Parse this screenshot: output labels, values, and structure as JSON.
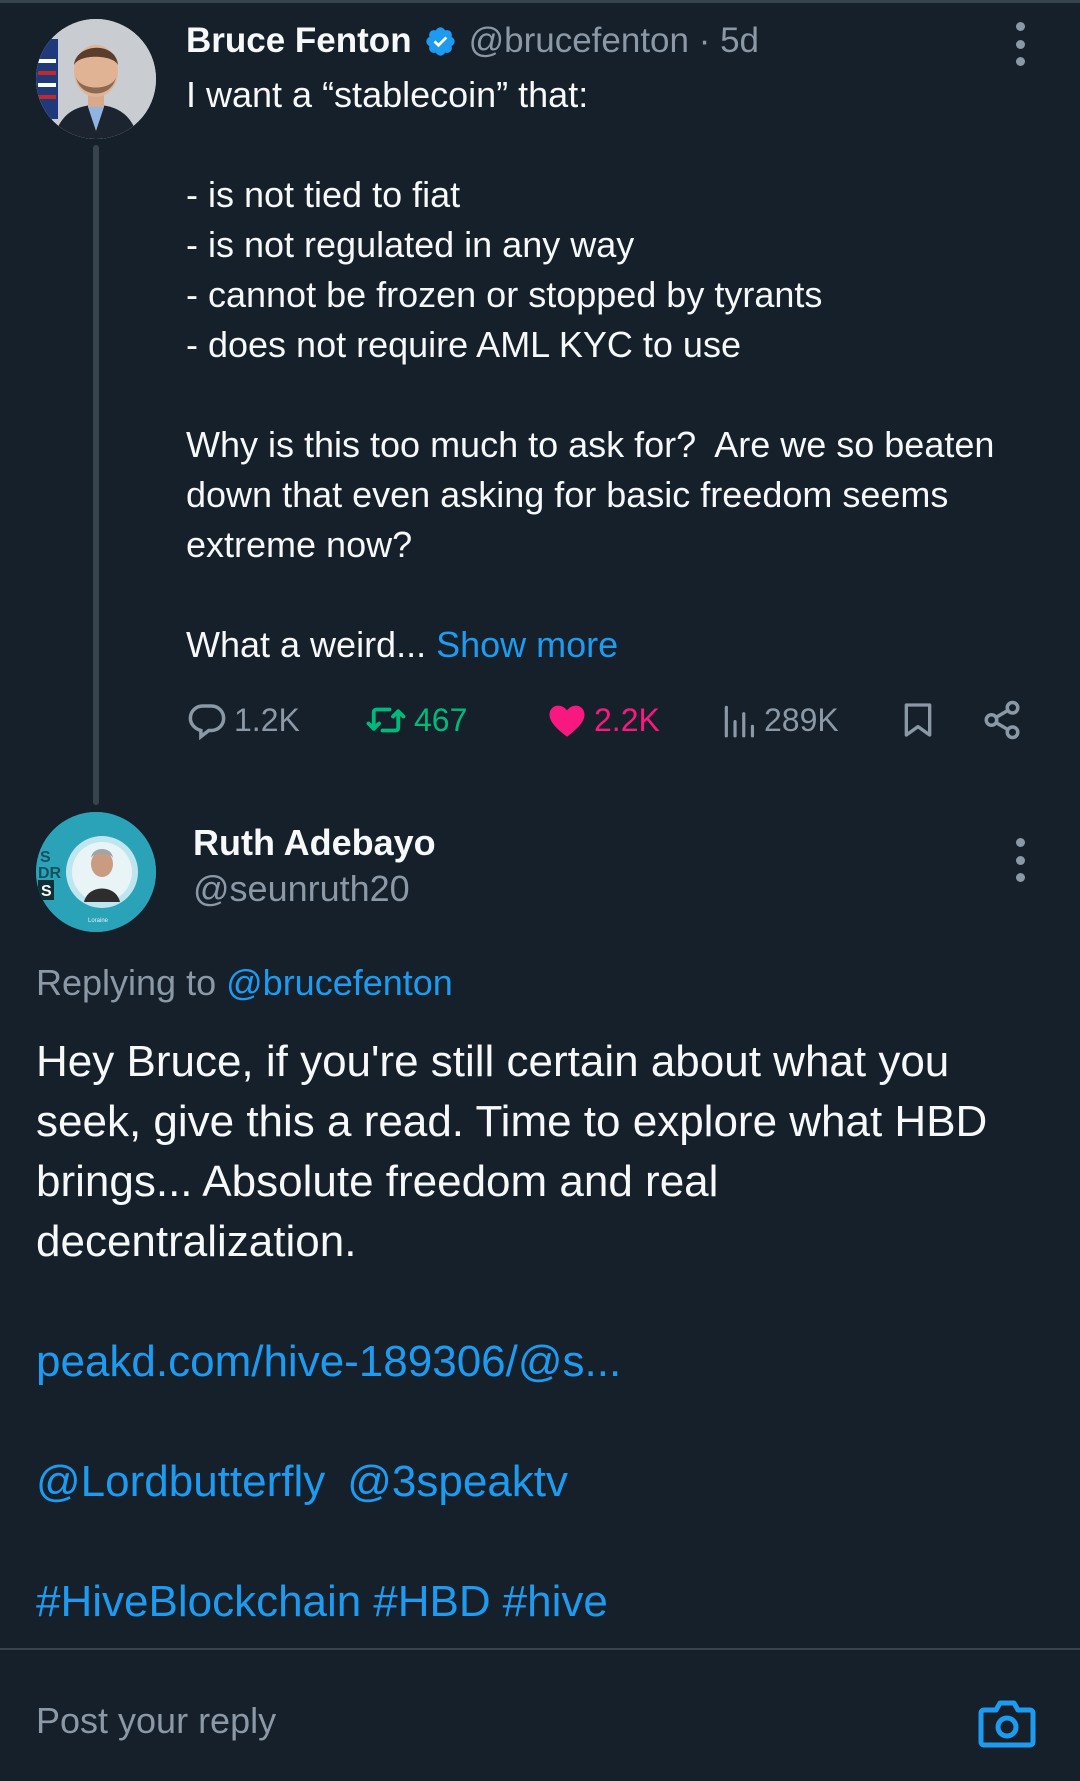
{
  "tweet": {
    "author_name": "Bruce Fenton",
    "author_handle": "@brucefenton",
    "separator": "·",
    "age": "5d",
    "verified": true,
    "body_text": "I want a “stablecoin” that:\n\n- is not tied to fiat\n- is not regulated in any way\n- cannot be frozen or stopped by tyrants\n- does not require AML KYC to use\n\nWhy is this too much to ask for?  Are we so beaten down that even asking for basic freedom seems extreme now?\n\nWhat a weird... ",
    "show_more_label": "Show more",
    "stats": {
      "replies": "1.2K",
      "retweets": "467",
      "likes": "2.2K",
      "views": "289K"
    }
  },
  "reply": {
    "author_name": "Ruth Adebayo",
    "author_handle": "@seunruth20",
    "replying_prefix": "Replying to",
    "replying_to": "@brucefenton",
    "body_text": "Hey Bruce, if you're still certain about what you seek, give this a read. Time to explore what HBD brings... Absolute freedom and real decentralization.",
    "link": "peakd.com/hive-189306/@s...",
    "mentions": [
      "@Lordbutterfly",
      "@3speaktv"
    ],
    "hashtags": [
      "#HiveBlockchain",
      "#HBD",
      "#hive"
    ]
  },
  "composer": {
    "placeholder": "Post your reply"
  },
  "colors": {
    "background": "#15202b",
    "accent": "#1d9bf0",
    "secondary_text": "#8b98a5",
    "retweet": "#00ba7c",
    "like": "#f91880",
    "divider": "#38444d"
  },
  "icons": [
    "more-vertical-icon",
    "verified-badge-icon",
    "reply-icon",
    "retweet-icon",
    "like-heart-icon",
    "views-icon",
    "bookmark-icon",
    "share-icon",
    "camera-icon"
  ]
}
